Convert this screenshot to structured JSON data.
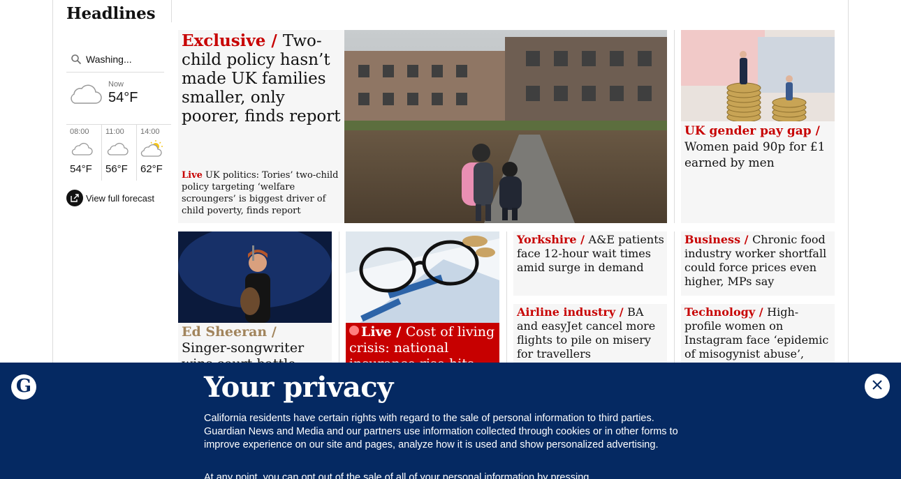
{
  "colors": {
    "news_red": "#c70000",
    "culture_tan": "#a1845c",
    "banner_blue": "#052962"
  },
  "sidebar": {
    "title": "Headlines",
    "weather": {
      "location": "Washing...",
      "now_label": "Now",
      "now_temp": "54°F",
      "now_icon": "cloud-icon",
      "hourly": [
        {
          "time": "08:00",
          "icon": "cloud-icon",
          "temp": "54°F"
        },
        {
          "time": "11:00",
          "icon": "cloud-icon",
          "temp": "56°F"
        },
        {
          "time": "14:00",
          "icon": "sun-cloud-icon",
          "temp": "62°F"
        }
      ],
      "forecast_link": "View full forecast"
    }
  },
  "main": {
    "lead": {
      "kicker": "Exclusive / ",
      "headline": "Two-child policy hasn’t made UK families smaller, only poorer, finds report",
      "sublink_live": "Live",
      "sublink_text": " UK politics: Tories’ two-child policy targeting ‘welfare scroungers’ is biggest driver of child poverty, finds report"
    },
    "gender_pay": {
      "kicker": "UK gender pay gap / ",
      "headline": "Women paid 90p for £1 earned by men"
    },
    "ed_sheeran": {
      "kicker": "Ed Sheeran / ",
      "headline": "Singer-songwriter wins court battle over Shape of You"
    },
    "cost_of_living": {
      "kicker": "Live / ",
      "headline": "Cost of living crisis: national insurance rise hits pay"
    },
    "yorkshire": {
      "kicker": "Yorkshire / ",
      "headline": "A&E patients face 12-hour wait times amid surge in demand"
    },
    "business": {
      "kicker": "Business / ",
      "headline": "Chronic food industry worker shortfall could force prices even higher, MPs say"
    },
    "airline": {
      "kicker": "Airline industry / ",
      "headline": "BA and easyJet cancel more flights to pile on misery for travellers"
    },
    "technology": {
      "kicker": "Technology / ",
      "headline": "High-profile women on Instagram face ‘epidemic of misogynist abuse’, study finds"
    }
  },
  "privacy": {
    "logo_letter": "G",
    "title": "Your privacy",
    "body": "California residents have certain rights with regard to the sale of personal information to third parties. Guardian News and Media and our partners use information collected through cookies or in other forms to improve experience on our site and pages, analyze how it is used and show personalized advertising.",
    "body2": "At any point, you can opt out of the sale of all of your personal information by pressing",
    "close_icon": "close-icon"
  }
}
